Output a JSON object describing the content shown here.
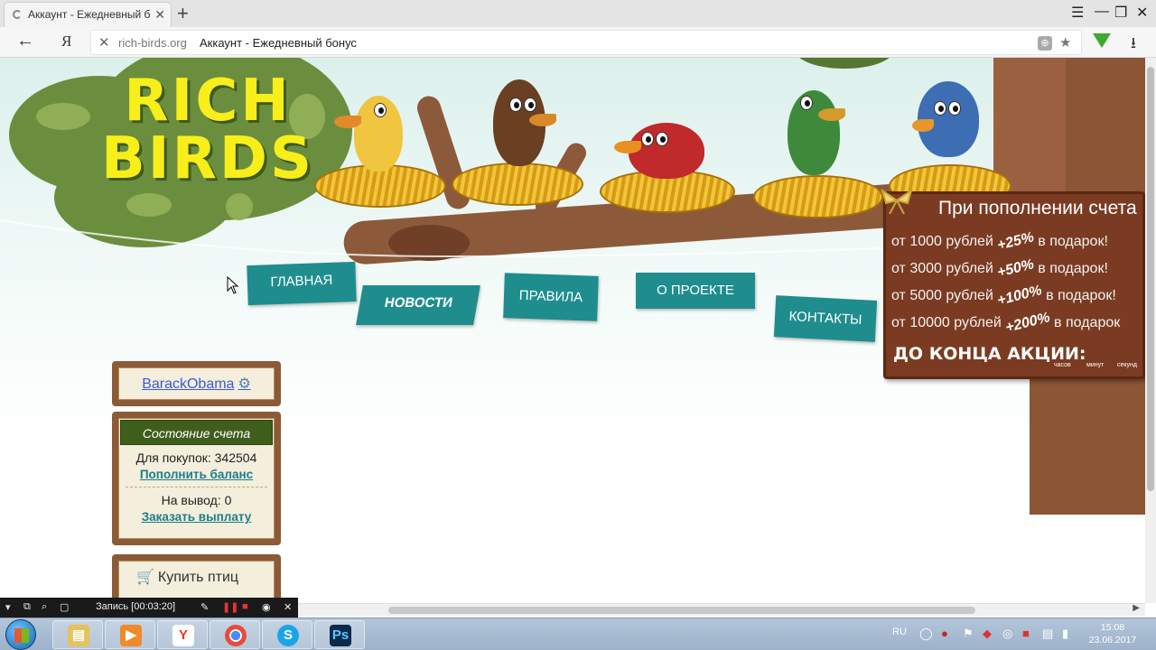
{
  "browser": {
    "tab_title": "Аккаунт - Ежедневный б",
    "tab_close": "✕",
    "new_tab": "+",
    "menu_icon": "☰",
    "minimize": "—",
    "restore": "❐",
    "close": "✕",
    "back": "←",
    "yandex_logo": "Я",
    "url_stop": "✕",
    "url_host": "rich-birds.org",
    "url_title": "Аккаунт - Ежедневный бонус",
    "download": "⭳"
  },
  "site": {
    "logo_line1": "RICH",
    "logo_line2": "BIRDS"
  },
  "nav": {
    "home": "ГЛАВНАЯ",
    "news": "НОВОСТИ",
    "rules": "ПРАВИЛА",
    "about": "О ПРОЕКТЕ",
    "contacts": "КОНТАКТЫ"
  },
  "promo": {
    "title": "При пополнении счета",
    "rows": [
      {
        "from": "от 1000 рублей",
        "bonus": "+25%",
        "suffix": "в подарок!"
      },
      {
        "from": "от 3000 рублей",
        "bonus": "+50%",
        "suffix": "в подарок!"
      },
      {
        "from": "от 5000 рублей",
        "bonus": "+100%",
        "suffix": "в подарок!"
      },
      {
        "from": "от 10000 рублей",
        "bonus": "+200%",
        "suffix": "в подарок"
      }
    ],
    "until_end": "ДО КОНЦА АКЦИИ:",
    "hours": "часов",
    "minutes": "минут",
    "seconds": "секунд"
  },
  "user": {
    "name": "BarackObama"
  },
  "account": {
    "header": "Состояние счета",
    "purchases_label": "Для покупок: 342504",
    "topup_link": "Пополнить баланс",
    "withdraw_label": "На вывод: 0",
    "payout_link": "Заказать выплату"
  },
  "sidebar": {
    "buy_birds": "Купить птиц"
  },
  "recorder": {
    "status": "Запись [00:03:20]"
  },
  "taskbar": {
    "lang": "RU",
    "time": "15:08",
    "date": "23.06.2017",
    "apps": [
      "file-explorer",
      "media-player",
      "yandex-browser",
      "chrome",
      "skype",
      "photoshop"
    ]
  },
  "colors": {
    "nav_teal": "#1f8d8e",
    "promo_brown": "#7b3b22",
    "logo_yellow": "#f8ee1a",
    "panel_header_green": "#3f5e1c",
    "link_blue": "#3b5bd6"
  }
}
